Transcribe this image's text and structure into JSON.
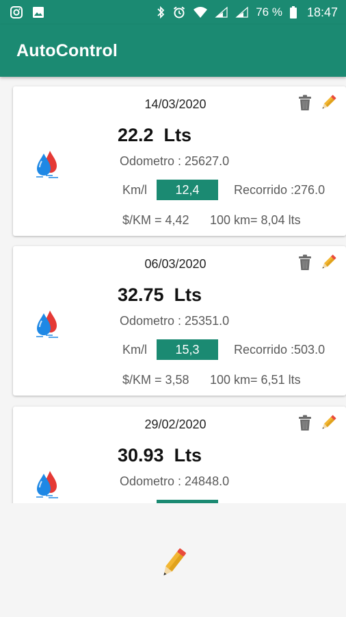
{
  "status_bar": {
    "left_icons": [
      "instagram-icon",
      "image-icon"
    ],
    "right_icons": [
      "bluetooth-icon",
      "alarm-icon",
      "wifi-icon",
      "signal-icon",
      "signal-icon"
    ],
    "battery": "76 %",
    "time": "18:47"
  },
  "app_bar": {
    "title": "AutoControl"
  },
  "colors": {
    "primary": "#1b8a72",
    "pencil": "#f2b632",
    "trash": "#6b6b6b",
    "drop_blue": "#1e88e5",
    "drop_red": "#e53935"
  },
  "records": [
    {
      "date": "14/03/2020",
      "liters": "22.2  Lts",
      "odometer": "Odometro : 25627.0",
      "kml_label": "Km/l",
      "kml": "12,4",
      "recorrido": "Recorrido :276.0",
      "cost_per_km": "$/KM = 4,42",
      "per_100km": "100 km= 8,04 lts"
    },
    {
      "date": "06/03/2020",
      "liters": "32.75  Lts",
      "odometer": "Odometro : 25351.0",
      "kml_label": "Km/l",
      "kml": "15,3",
      "recorrido": "Recorrido :503.0",
      "cost_per_km": "$/KM = 3,58",
      "per_100km": "100 km= 6,51 lts"
    },
    {
      "date": "29/02/2020",
      "liters": "30.93  Lts",
      "odometer": "Odometro : 24848.0",
      "kml_label": "",
      "kml": "",
      "recorrido": "",
      "cost_per_km": "",
      "per_100km": ""
    }
  ]
}
